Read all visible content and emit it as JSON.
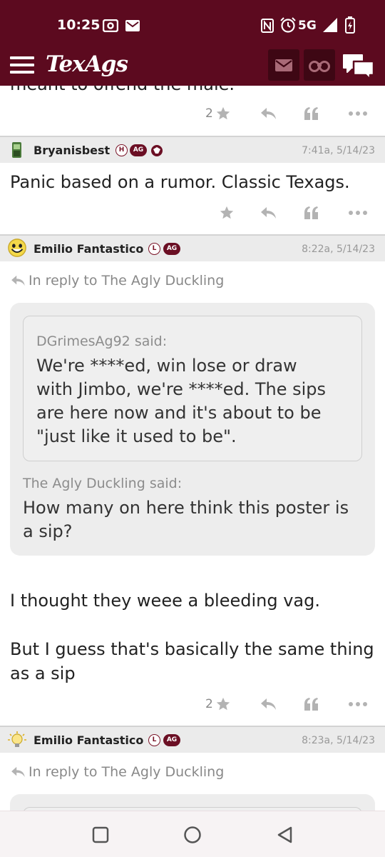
{
  "status_bar": {
    "time": "10:25",
    "network": "5G",
    "icons": [
      "cast-icon",
      "mail-icon",
      "nfc-icon",
      "alarm-icon",
      "signal-icon",
      "battery-icon"
    ]
  },
  "app_bar": {
    "logo": "TexAgs",
    "brand_color": "#5c0a1f",
    "icons": [
      "hamburger-menu-icon",
      "mail-icon",
      "binoculars-icon",
      "chat-icon"
    ]
  },
  "clipped_text": "meant to offend the male.",
  "posts": [
    {
      "actions": {
        "star_count": "2"
      }
    },
    {
      "username": "Bryanisbest",
      "badges": [
        "H",
        "AG"
      ],
      "timestamp": "7:41a, 5/14/23",
      "body": "Panic based on a rumor. Classic Texags.",
      "actions": {
        "star_count": ""
      }
    },
    {
      "username": "Emilio Fantastico",
      "badges": [
        "L",
        "AG"
      ],
      "timestamp": "8:22a, 5/14/23",
      "reply_to": "In reply to The Agly Duckling",
      "nested_quote": {
        "said": "DGrimesAg92 said:",
        "text": [
          "We're ****ed, win lose or draw",
          "with Jimbo, we're ****ed. The sips",
          "are here now and it's about to be",
          "\"just like it used to be\"."
        ]
      },
      "quote": {
        "said": "The Agly Duckling said:",
        "text": [
          "How many on here think this poster is",
          "a sip?"
        ]
      },
      "body_lines": [
        "I thought they weee a bleeding vag.",
        "",
        "But I guess that's basically the same thing",
        "as a sip"
      ],
      "actions": {
        "star_count": "2"
      }
    },
    {
      "username": "Emilio Fantastico",
      "badges": [
        "L",
        "AG"
      ],
      "timestamp": "8:23a, 5/14/23",
      "reply_to": "In reply to The Agly Duckling"
    }
  ],
  "nav_bar": {
    "icons": [
      "recents-icon",
      "home-icon",
      "back-icon"
    ]
  }
}
